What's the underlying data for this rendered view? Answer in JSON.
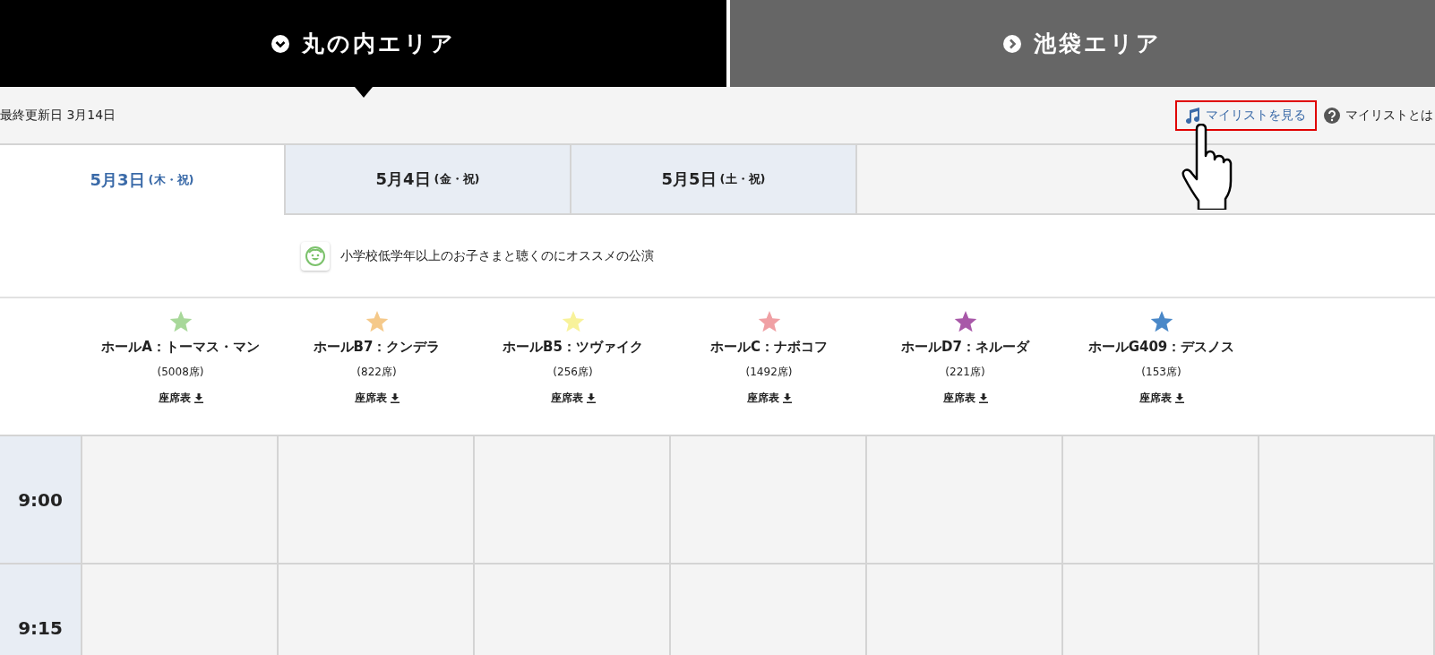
{
  "area_tabs": [
    {
      "label": "丸の内エリア",
      "selected": true
    },
    {
      "label": "池袋エリア",
      "selected": false
    }
  ],
  "updated": "最終更新日 3月14日",
  "links": [
    {
      "kind": "mylist",
      "label": "マイリストを見る",
      "highlighted": true
    },
    {
      "kind": "help",
      "label": "マイリストとは",
      "highlighted": false
    }
  ],
  "date_tabs": [
    {
      "date": "5月3日",
      "days": "(木・祝)",
      "selected": true
    },
    {
      "date": "5月4日",
      "days": "(金・祝)",
      "selected": false
    },
    {
      "date": "5月5日",
      "days": "(土・祝)",
      "selected": false
    }
  ],
  "notice": "小学校低学年以上のお子さまと聴くのにオススメの公演",
  "halls": [
    {
      "name": "ホールA：トーマス・マン",
      "seats": "(5008席)",
      "chart": "座席表",
      "color": "#a8d89a"
    },
    {
      "name": "ホールB7：クンデラ",
      "seats": "(822席)",
      "chart": "座席表",
      "color": "#f5c98a"
    },
    {
      "name": "ホールB5：ツヴァイク",
      "seats": "(256席)",
      "chart": "座席表",
      "color": "#f8f29a"
    },
    {
      "name": "ホールC：ナボコフ",
      "seats": "(1492席)",
      "chart": "座席表",
      "color": "#f0a0a4"
    },
    {
      "name": "ホールD7：ネルーダ",
      "seats": "(221席)",
      "chart": "座席表",
      "color": "#a858a8"
    },
    {
      "name": "ホールG409：デスノス",
      "seats": "(153席)",
      "chart": "座席表",
      "color": "#4a88c8"
    }
  ],
  "times": [
    "9:00",
    "9:15"
  ]
}
